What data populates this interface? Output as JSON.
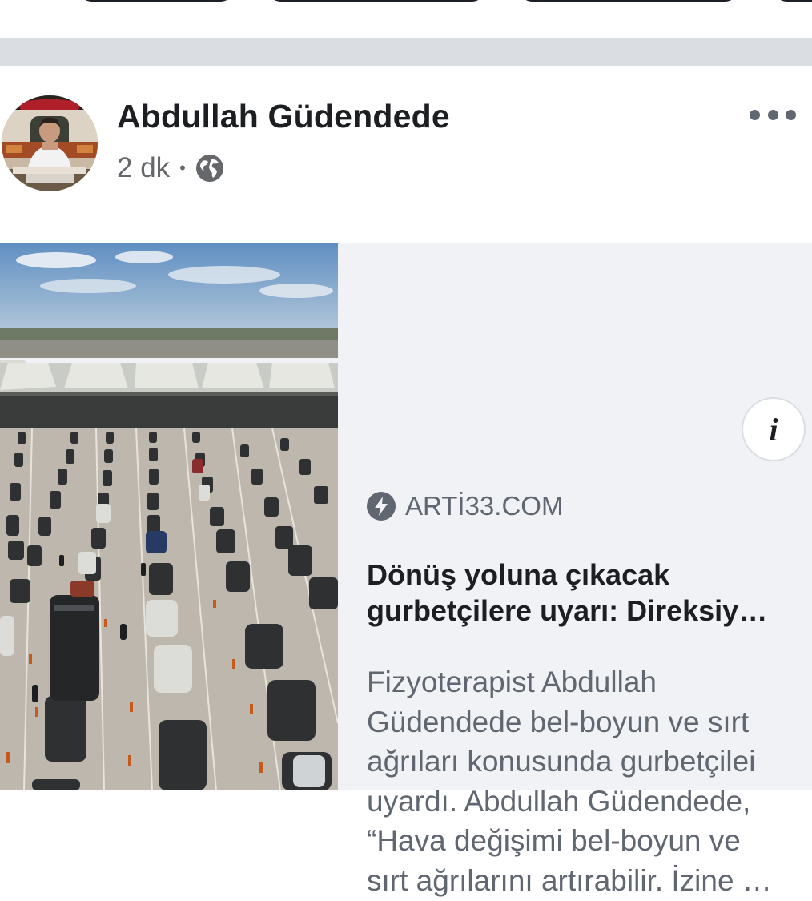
{
  "post": {
    "author_name": "Abdullah Güdendede",
    "timestamp": "2 dk",
    "separator_dot": "•",
    "audience_icon": "globe-icon",
    "more_icon": "more-options-icon"
  },
  "link_preview": {
    "source_icon": "instant-articles-bolt-icon",
    "source": "ARTİ33.COM",
    "info_icon_label": "i",
    "headline_lines": [
      "Dönüş yoluna çıkacak",
      "gurbetçilere uyarı: Direksiy…"
    ],
    "description_lines": [
      "Fizyoterapist Abdullah",
      "Güdendede bel-boyun ve sırt",
      "ağrıları konusunda gurbetçilei",
      "uyardı. Abdullah Güdendede,",
      "“Hava değişimi bel-boyun ve",
      "sırt ağrılarını artırabilir. İzine …"
    ]
  },
  "colors": {
    "card_background": "#f0f2f5",
    "separator": "#dadde1",
    "primary_text": "#1c1e21",
    "secondary_text": "#606770"
  }
}
